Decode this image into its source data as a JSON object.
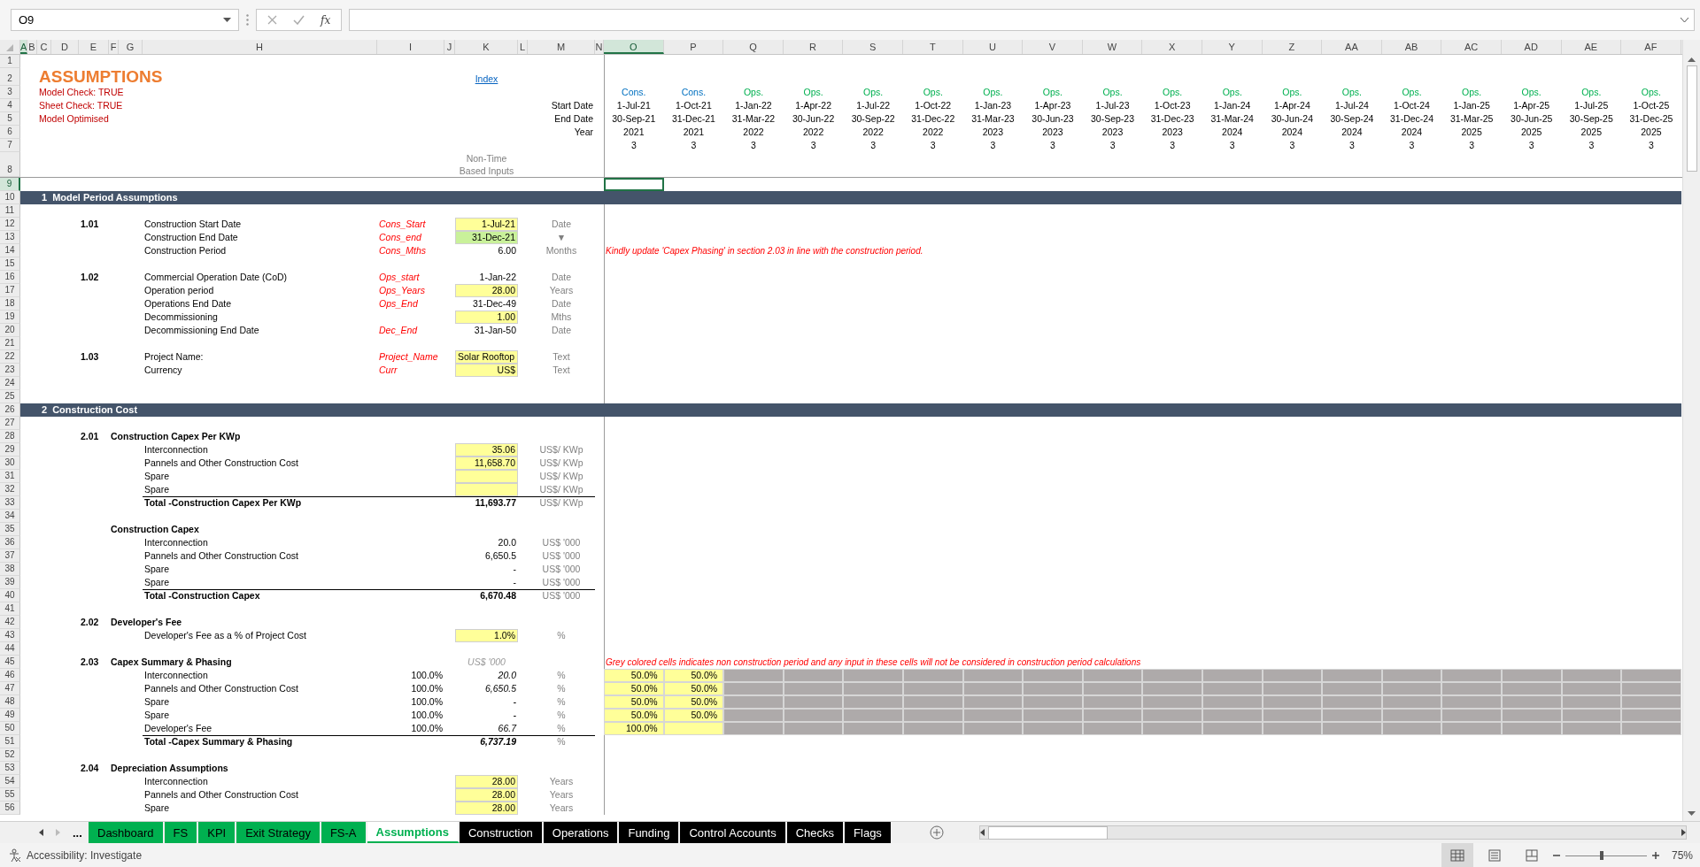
{
  "formula_bar": {
    "name_box": "O9",
    "function_label": "fx"
  },
  "columns": [
    {
      "letter": "A",
      "selected": true
    },
    {
      "letter": "B",
      "selected": false
    },
    {
      "letter": "C",
      "selected": false
    },
    {
      "letter": "D",
      "selected": false
    },
    {
      "letter": "E",
      "selected": false
    },
    {
      "letter": "F",
      "selected": false
    },
    {
      "letter": "G",
      "selected": false
    },
    {
      "letter": "H",
      "selected": false
    },
    {
      "letter": "I",
      "selected": false
    },
    {
      "letter": "J",
      "selected": false
    },
    {
      "letter": "K",
      "selected": false
    },
    {
      "letter": "L",
      "selected": false
    },
    {
      "letter": "M",
      "selected": false
    },
    {
      "letter": "N",
      "selected": false
    }
  ],
  "timeline": [
    {
      "letter": "O",
      "selected": true,
      "kind": "cons",
      "flag": "Cons.",
      "start": "1-Jul-21",
      "end": "30-Sep-21",
      "year": "2021",
      "months": "3"
    },
    {
      "letter": "P",
      "selected": false,
      "kind": "cons",
      "flag": "Cons.",
      "start": "1-Oct-21",
      "end": "31-Dec-21",
      "year": "2021",
      "months": "3"
    },
    {
      "letter": "Q",
      "selected": false,
      "kind": "ops",
      "flag": "Ops.",
      "start": "1-Jan-22",
      "end": "31-Mar-22",
      "year": "2022",
      "months": "3"
    },
    {
      "letter": "R",
      "selected": false,
      "kind": "ops",
      "flag": "Ops.",
      "start": "1-Apr-22",
      "end": "30-Jun-22",
      "year": "2022",
      "months": "3"
    },
    {
      "letter": "S",
      "selected": false,
      "kind": "ops",
      "flag": "Ops.",
      "start": "1-Jul-22",
      "end": "30-Sep-22",
      "year": "2022",
      "months": "3"
    },
    {
      "letter": "T",
      "selected": false,
      "kind": "ops",
      "flag": "Ops.",
      "start": "1-Oct-22",
      "end": "31-Dec-22",
      "year": "2022",
      "months": "3"
    },
    {
      "letter": "U",
      "selected": false,
      "kind": "ops",
      "flag": "Ops.",
      "start": "1-Jan-23",
      "end": "31-Mar-23",
      "year": "2023",
      "months": "3"
    },
    {
      "letter": "V",
      "selected": false,
      "kind": "ops",
      "flag": "Ops.",
      "start": "1-Apr-23",
      "end": "30-Jun-23",
      "year": "2023",
      "months": "3"
    },
    {
      "letter": "W",
      "selected": false,
      "kind": "ops",
      "flag": "Ops.",
      "start": "1-Jul-23",
      "end": "30-Sep-23",
      "year": "2023",
      "months": "3"
    },
    {
      "letter": "X",
      "selected": false,
      "kind": "ops",
      "flag": "Ops.",
      "start": "1-Oct-23",
      "end": "31-Dec-23",
      "year": "2023",
      "months": "3"
    },
    {
      "letter": "Y",
      "selected": false,
      "kind": "ops",
      "flag": "Ops.",
      "start": "1-Jan-24",
      "end": "31-Mar-24",
      "year": "2024",
      "months": "3"
    },
    {
      "letter": "Z",
      "selected": false,
      "kind": "ops",
      "flag": "Ops.",
      "start": "1-Apr-24",
      "end": "30-Jun-24",
      "year": "2024",
      "months": "3"
    },
    {
      "letter": "AA",
      "selected": false,
      "kind": "ops",
      "flag": "Ops.",
      "start": "1-Jul-24",
      "end": "30-Sep-24",
      "year": "2024",
      "months": "3"
    },
    {
      "letter": "AB",
      "selected": false,
      "kind": "ops",
      "flag": "Ops.",
      "start": "1-Oct-24",
      "end": "31-Dec-24",
      "year": "2024",
      "months": "3"
    },
    {
      "letter": "AC",
      "selected": false,
      "kind": "ops",
      "flag": "Ops.",
      "start": "1-Jan-25",
      "end": "31-Mar-25",
      "year": "2025",
      "months": "3"
    },
    {
      "letter": "AD",
      "selected": false,
      "kind": "ops",
      "flag": "Ops.",
      "start": "1-Apr-25",
      "end": "30-Jun-25",
      "year": "2025",
      "months": "3"
    },
    {
      "letter": "AE",
      "selected": false,
      "kind": "ops",
      "flag": "Ops.",
      "start": "1-Jul-25",
      "end": "30-Sep-25",
      "year": "2025",
      "months": "3"
    },
    {
      "letter": "AF",
      "selected": false,
      "kind": "ops",
      "flag": "Ops.",
      "start": "1-Oct-25",
      "end": "31-Dec-25",
      "year": "2025",
      "months": "3"
    }
  ],
  "rows": [
    {
      "number": "1",
      "selected": false
    },
    {
      "number": "2",
      "selected": false,
      "title": "ASSUMPTIONS",
      "link": "Index"
    },
    {
      "number": "3",
      "selected": false,
      "check": "Model Check: TRUE",
      "kind": "flag"
    },
    {
      "number": "4",
      "selected": false,
      "check": "Sheet Check: TRUE",
      "timeline_label": "Start Date",
      "kind": "start"
    },
    {
      "number": "5",
      "selected": false,
      "check": "Model Optimised",
      "timeline_label": "End Date",
      "kind": "end"
    },
    {
      "number": "6",
      "selected": false,
      "timeline_label": "Year",
      "kind": "year"
    },
    {
      "number": "7",
      "selected": false,
      "kind": "months"
    },
    {
      "number": "8",
      "selected": false,
      "inputs_note": "Non-Time Based Inputs",
      "pane_split": true
    },
    {
      "number": "9",
      "selected": true
    },
    {
      "number": "10",
      "selected": false,
      "band": {
        "number": "1",
        "title": "Model Period Assumptions"
      }
    },
    {
      "number": "11",
      "selected": false
    },
    {
      "number": "12",
      "selected": false,
      "ref": "1.01",
      "label": "Construction Start Date",
      "range_name": "Cons_Start",
      "value": {
        "kind": "input",
        "text": "1-Jul-21"
      },
      "unit": "Date"
    },
    {
      "number": "13",
      "selected": false,
      "label": "Construction End Date",
      "range_name": "Cons_end",
      "value": {
        "kind": "confirmed",
        "text": "31-Dec-21"
      },
      "unit": "▼"
    },
    {
      "number": "14",
      "selected": false,
      "label": "Construction Period",
      "range_name": "Cons_Mths",
      "value": {
        "kind": "plain",
        "text": "6.00"
      },
      "unit": "Months",
      "note": "Kindly update 'Capex Phasing' in section 2.03 in line with the construction period."
    },
    {
      "number": "15",
      "selected": false
    },
    {
      "number": "16",
      "selected": false,
      "ref": "1.02",
      "label": "Commercial Operation Date (CoD)",
      "range_name": "Ops_start",
      "value": {
        "kind": "plain",
        "text": "1-Jan-22"
      },
      "unit": "Date"
    },
    {
      "number": "17",
      "selected": false,
      "label": "Operation period",
      "range_name": "Ops_Years",
      "value": {
        "kind": "input",
        "text": "28.00"
      },
      "unit": "Years"
    },
    {
      "number": "18",
      "selected": false,
      "label": "Operations End Date",
      "range_name": "Ops_End",
      "value": {
        "kind": "plain",
        "text": "31-Dec-49"
      },
      "unit": "Date"
    },
    {
      "number": "19",
      "selected": false,
      "label": "Decommissioning",
      "value": {
        "kind": "input",
        "text": "1.00"
      },
      "unit": "Mths"
    },
    {
      "number": "20",
      "selected": false,
      "label": "Decommissioning End Date",
      "range_name": "Dec_End",
      "value": {
        "kind": "plain",
        "text": "31-Jan-50"
      },
      "unit": "Date"
    },
    {
      "number": "21",
      "selected": false
    },
    {
      "number": "22",
      "selected": false,
      "ref": "1.03",
      "label": "Project Name:",
      "range_name": "Project_Name",
      "value": {
        "kind": "input_text",
        "text": "Solar Rooftop"
      },
      "unit": "Text"
    },
    {
      "number": "23",
      "selected": false,
      "label": "Currency",
      "range_name": "Curr",
      "value": {
        "kind": "input",
        "text": "US$"
      },
      "unit": "Text"
    },
    {
      "number": "24",
      "selected": false
    },
    {
      "number": "25",
      "selected": false
    },
    {
      "number": "26",
      "selected": false,
      "band": {
        "number": "2",
        "title": "Construction Cost"
      }
    },
    {
      "number": "27",
      "selected": false
    },
    {
      "number": "28",
      "selected": false,
      "ref": "2.01",
      "heading": "Construction Capex Per KWp"
    },
    {
      "number": "29",
      "selected": false,
      "label": "Interconnection",
      "value": {
        "kind": "input",
        "text": "35.06"
      },
      "unit": "US$/ KWp"
    },
    {
      "number": "30",
      "selected": false,
      "label": "Pannels and Other Construction Cost",
      "value": {
        "kind": "input",
        "text": "11,658.70"
      },
      "unit": "US$/ KWp"
    },
    {
      "number": "31",
      "selected": false,
      "label": "Spare",
      "value": {
        "kind": "input"
      },
      "unit": "US$/ KWp"
    },
    {
      "number": "32",
      "selected": false,
      "label": "Spare",
      "value": {
        "kind": "input"
      },
      "unit": "US$/ KWp"
    },
    {
      "number": "33",
      "selected": false,
      "total": true,
      "label": "Total -Construction Capex Per KWp",
      "value": {
        "kind": "bold",
        "text": "11,693.77"
      },
      "unit": "US$/ KWp"
    },
    {
      "number": "34",
      "selected": false
    },
    {
      "number": "35",
      "selected": false,
      "heading": "Construction Capex"
    },
    {
      "number": "36",
      "selected": false,
      "label": "Interconnection",
      "value": {
        "kind": "plain",
        "text": "20.0"
      },
      "unit": "US$ '000"
    },
    {
      "number": "37",
      "selected": false,
      "label": "Pannels and Other Construction Cost",
      "value": {
        "kind": "plain",
        "text": "6,650.5"
      },
      "unit": "US$ '000"
    },
    {
      "number": "38",
      "selected": false,
      "label": "Spare",
      "value": {
        "kind": "plain",
        "text": "-"
      },
      "unit": "US$ '000"
    },
    {
      "number": "39",
      "selected": false,
      "label": "Spare",
      "value": {
        "kind": "plain",
        "text": "-"
      },
      "unit": "US$ '000"
    },
    {
      "number": "40",
      "selected": false,
      "total": true,
      "label": "Total -Construction Capex",
      "value": {
        "kind": "bold",
        "text": "6,670.48"
      },
      "unit": "US$ '000"
    },
    {
      "number": "41",
      "selected": false
    },
    {
      "number": "42",
      "selected": false,
      "ref": "2.02",
      "heading": "Developer's Fee"
    },
    {
      "number": "43",
      "selected": false,
      "label": "Developer's Fee as a % of Project Cost",
      "value": {
        "kind": "input",
        "text": "1.0%"
      },
      "unit": "%"
    },
    {
      "number": "44",
      "selected": false
    },
    {
      "number": "45",
      "selected": false,
      "ref": "2.03",
      "heading": "Capex Summary & Phasing",
      "value": {
        "kind": "hint",
        "text": "US$ '000"
      },
      "note": "Grey colored cells indicates non construction period and any input in these cells will not be considered in construction period calculations"
    },
    {
      "number": "46",
      "selected": false,
      "label": "Interconnection",
      "pct": "100.0%",
      "value": {
        "kind": "italic",
        "text": "20.0"
      },
      "unit": "%",
      "phasing": [
        "50.0%",
        "50.0%"
      ]
    },
    {
      "number": "47",
      "selected": false,
      "label": "Pannels and Other Construction Cost",
      "pct": "100.0%",
      "value": {
        "kind": "italic",
        "text": "6,650.5"
      },
      "unit": "%",
      "phasing": [
        "50.0%",
        "50.0%"
      ]
    },
    {
      "number": "48",
      "selected": false,
      "label": "Spare",
      "pct": "100.0%",
      "value": {
        "kind": "italic",
        "text": "-"
      },
      "unit": "%",
      "phasing": [
        "50.0%",
        "50.0%"
      ]
    },
    {
      "number": "49",
      "selected": false,
      "label": "Spare",
      "pct": "100.0%",
      "value": {
        "kind": "italic",
        "text": "-"
      },
      "unit": "%",
      "phasing": [
        "50.0%",
        "50.0%"
      ]
    },
    {
      "number": "50",
      "selected": false,
      "label": "Developer's Fee",
      "pct": "100.0%",
      "value": {
        "kind": "italic",
        "text": "66.7"
      },
      "unit": "%",
      "phasing": [
        "100.0%"
      ]
    },
    {
      "number": "51",
      "selected": false,
      "total": true,
      "label": "Total -Capex Summary & Phasing",
      "value": {
        "kind": "bold_italic",
        "text": "6,737.19"
      },
      "unit": "%"
    },
    {
      "number": "52",
      "selected": false
    },
    {
      "number": "53",
      "selected": false,
      "ref": "2.04",
      "heading": "Depreciation Assumptions"
    },
    {
      "number": "54",
      "selected": false,
      "label": "Interconnection",
      "value": {
        "kind": "input",
        "text": "28.00"
      },
      "unit": "Years"
    },
    {
      "number": "55",
      "selected": false,
      "label": "Pannels and Other Construction Cost",
      "value": {
        "kind": "input",
        "text": "28.00"
      },
      "unit": "Years"
    },
    {
      "number": "56",
      "selected": false,
      "label": "Spare",
      "value": {
        "kind": "input",
        "text": "28.00"
      },
      "unit": "Years"
    }
  ],
  "tab_nav": {
    "more": "..."
  },
  "sheet_tabs": [
    {
      "label": "Dashboard",
      "color": "#00b050",
      "selected": false
    },
    {
      "label": "FS",
      "color": "#00b050",
      "selected": false
    },
    {
      "label": "KPI",
      "color": "#00b050",
      "selected": false
    },
    {
      "label": "Exit Strategy",
      "color": "#00b050",
      "selected": false
    },
    {
      "label": "FS-A",
      "color": "#00b050",
      "selected": false
    },
    {
      "label": "Assumptions",
      "color": "#00b050",
      "selected": true
    },
    {
      "label": "Construction",
      "color": "#000000",
      "selected": false
    },
    {
      "label": "Operations",
      "color": "#000000",
      "selected": false
    },
    {
      "label": "Funding",
      "color": "#000000",
      "selected": false
    },
    {
      "label": "Control Accounts",
      "color": "#000000",
      "selected": false
    },
    {
      "label": "Checks",
      "color": "#000000",
      "selected": false
    },
    {
      "label": "Flags",
      "color": "#000000",
      "selected": false
    }
  ],
  "status_bar": {
    "accessibility": "Accessibility: Investigate",
    "views": [
      {
        "kind": "normal",
        "selected": true
      },
      {
        "kind": "page_layout",
        "selected": false
      },
      {
        "kind": "page_break",
        "selected": false
      }
    ],
    "zoom_slider": {
      "level": 0.45
    },
    "zoom": "75%"
  }
}
